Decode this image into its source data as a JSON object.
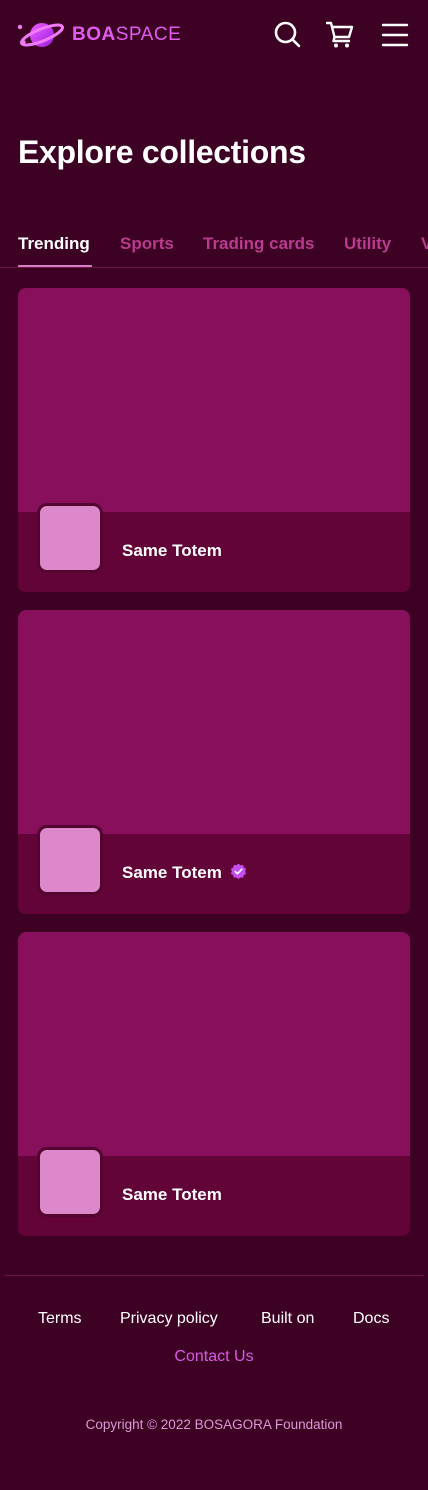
{
  "header": {
    "brand_bold": "BOA",
    "brand_regular": "SPACE",
    "icons": [
      "logo-planet-icon",
      "search-icon",
      "cart-icon",
      "menu-icon"
    ]
  },
  "page": {
    "title": "Explore collections"
  },
  "tabs": [
    {
      "label": "Trending",
      "active": true
    },
    {
      "label": "Sports",
      "active": false
    },
    {
      "label": "Trading cards",
      "active": false
    },
    {
      "label": "Utility",
      "active": false
    },
    {
      "label": "V",
      "active": false
    }
  ],
  "collections": [
    {
      "name": "Same Totem",
      "verified": false
    },
    {
      "name": "Same Totem",
      "verified": true
    },
    {
      "name": "Same Totem",
      "verified": false
    }
  ],
  "footer": {
    "links": [
      "Terms",
      "Privacy policy",
      "Built on",
      "Docs"
    ],
    "contact": "Contact Us",
    "copyright": "Copyright © 2022 BOSAGORA Foundation"
  },
  "colors": {
    "background": "#3d0123",
    "card": "#870f5c",
    "card_footer": "#620437",
    "avatar": "#dd88ca",
    "accent": "#d65be6",
    "tab_inactive": "#b93c8e"
  }
}
